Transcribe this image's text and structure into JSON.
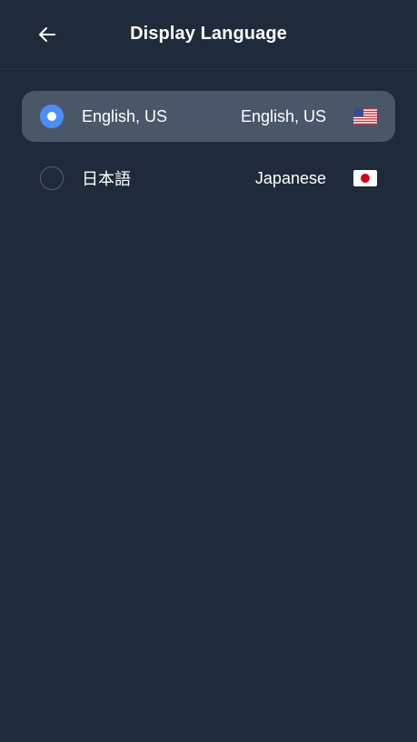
{
  "header": {
    "title": "Display Language",
    "back_icon": "arrow-left-icon"
  },
  "languages": [
    {
      "native": "English, US",
      "english": "English, US",
      "flag_icon": "us-flag-icon",
      "selected": true
    },
    {
      "native": "日本語",
      "english": "Japanese",
      "flag_icon": "japan-flag-icon",
      "selected": false
    }
  ],
  "colors": {
    "background": "#1f2a3b",
    "selected_row": "#4a5769",
    "accent": "#4d8df6"
  }
}
